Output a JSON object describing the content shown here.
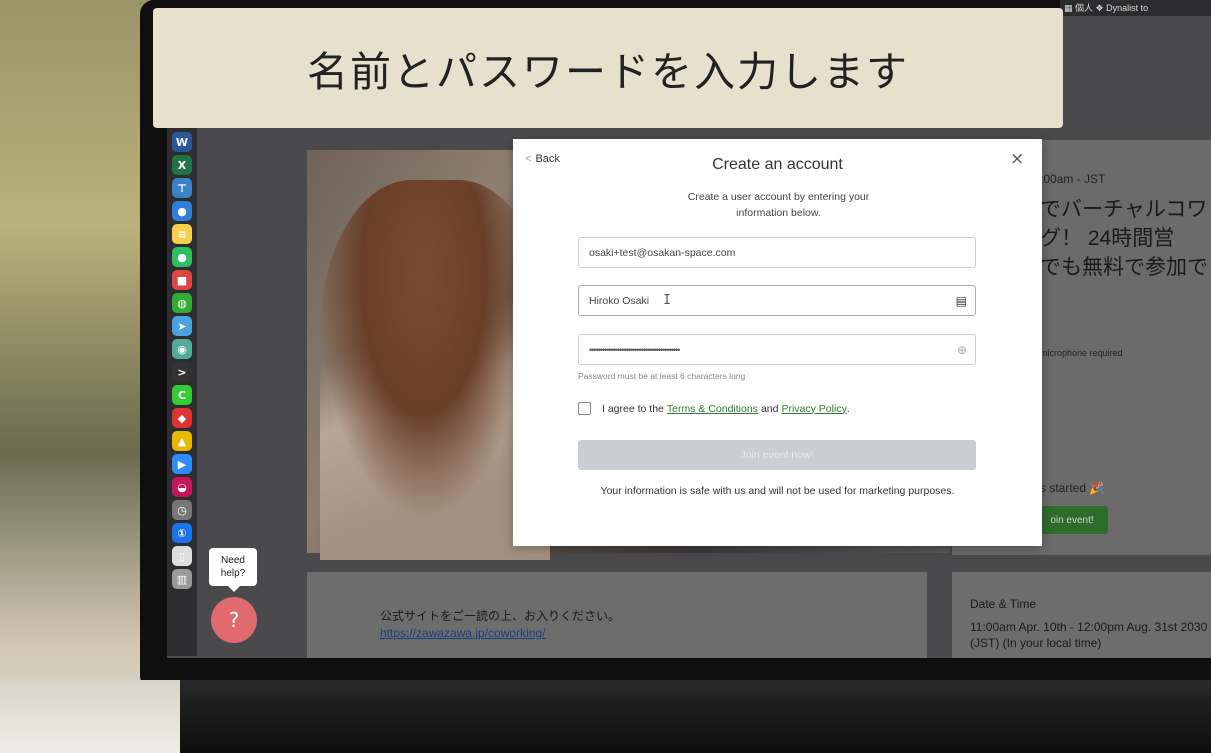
{
  "caption": "名前とパスワードを入力します",
  "menubar": {
    "text": "▦ 個人   ❖ Dynalist to"
  },
  "modal": {
    "back_label": "Back",
    "close_icon": "×",
    "title": "Create an account",
    "subtitle": "Create a user account by entering your information below.",
    "email_value": "osaki+test@osakan-space.com",
    "name_value": "Hiroko Osaki",
    "password_dots": "••••••••••••••••••••••••••••••••••••••••••",
    "password_hint": "Password must be at least 6 characters long",
    "agree_prefix": "I agree to the",
    "terms_link": "Terms & Conditions",
    "agree_and": "and",
    "privacy_link": "Privacy Policy",
    "agree_suffix": ".",
    "join_button": "Join event now!",
    "safe_text": "Your information is safe with us and will not be used for marketing purposes."
  },
  "background_page": {
    "time_text": ":00am - JST",
    "jp_headline": "でバーチャルコワ\nグ！ 24時間営\nでも無料で参加で",
    "mic_text": "microphone required",
    "started_text": "s started 🎉",
    "join_event_button": "oin event!",
    "notice_text": "公式サイトをご一読の上、お入りください。",
    "notice_link": "https://zawazawa.jp/coworking/",
    "date_time_title": "Date & Time",
    "date_time_text": "11:00am Apr. 10th - 12:00pm Aug. 31st 2030 (JST) (In your local time)"
  },
  "help": {
    "bubble_text": "Need help?",
    "button_icon": "?"
  },
  "dock_icons": [
    {
      "name": "word-icon",
      "glyph": "W",
      "color": "#2b579a"
    },
    {
      "name": "excel-icon",
      "glyph": "X",
      "color": "#217346"
    },
    {
      "name": "keynote-icon",
      "glyph": "⊤",
      "color": "#3b82c4"
    },
    {
      "name": "maps-icon",
      "glyph": "●",
      "color": "#2f7fd6"
    },
    {
      "name": "notes-icon",
      "glyph": "≡",
      "color": "#f5d04a"
    },
    {
      "name": "evernote-icon",
      "glyph": "●",
      "color": "#2dbe60"
    },
    {
      "name": "app-red-icon",
      "glyph": "■",
      "color": "#d44"
    },
    {
      "name": "globe-icon",
      "glyph": "◍",
      "color": "#3a3"
    },
    {
      "name": "telegram-icon",
      "glyph": "➤",
      "color": "#4aa3df"
    },
    {
      "name": "chrome-icon",
      "glyph": "◉",
      "color": "#5a9"
    },
    {
      "name": "terminal-icon",
      "glyph": ">",
      "color": "#333"
    },
    {
      "name": "c-app-icon",
      "glyph": "C",
      "color": "#3c3"
    },
    {
      "name": "app-red2-icon",
      "glyph": "◆",
      "color": "#d33"
    },
    {
      "name": "warning-icon",
      "glyph": "▲",
      "color": "#e6b800"
    },
    {
      "name": "zoom-icon",
      "glyph": "▶",
      "color": "#2d8cff"
    },
    {
      "name": "slack-icon",
      "glyph": "◒",
      "color": "#c2185b"
    },
    {
      "name": "clock-icon",
      "glyph": "◷",
      "color": "#777"
    },
    {
      "name": "onepassword-icon",
      "glyph": "①",
      "color": "#1a73e8"
    },
    {
      "name": "file-icon",
      "glyph": "▯",
      "color": "#ddd"
    },
    {
      "name": "trash-icon",
      "glyph": "▥",
      "color": "#999"
    }
  ]
}
